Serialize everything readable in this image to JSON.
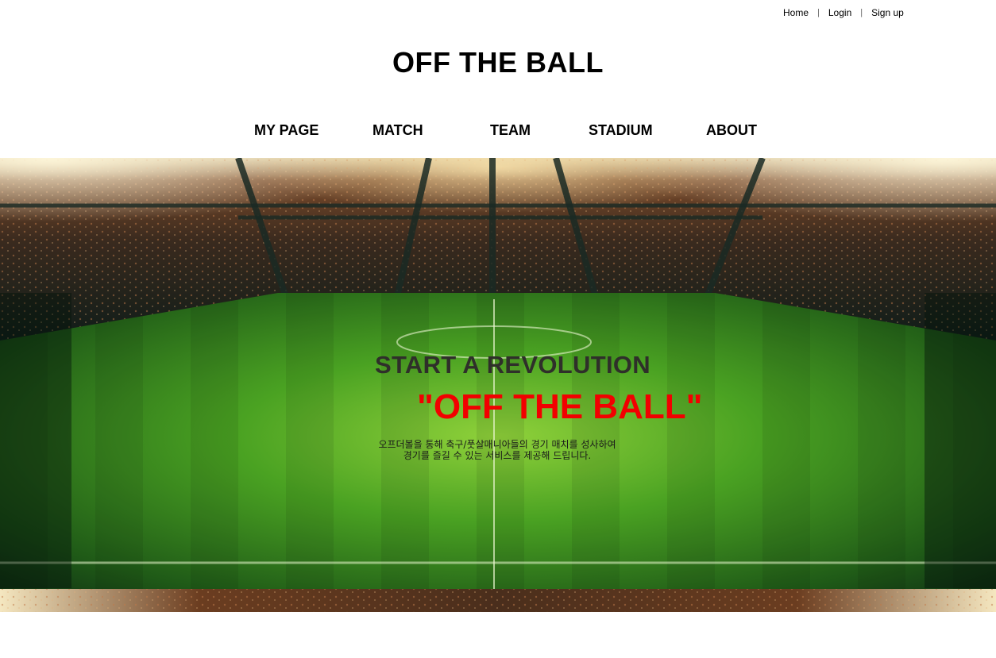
{
  "util_nav": {
    "home": "Home",
    "login": "Login",
    "signup": "Sign up",
    "separator": "|"
  },
  "logo": "OFF THE BALL",
  "main_nav": [
    {
      "label": "MY PAGE"
    },
    {
      "label": "MATCH"
    },
    {
      "label": "TEAM"
    },
    {
      "label": "STADIUM"
    },
    {
      "label": "ABOUT"
    }
  ],
  "hero": {
    "title": "START A REVOLUTION",
    "brand": "\"OFF THE BALL\"",
    "description_line1": "오프더볼을 통해 축구/풋살매니아들의 경기 매치를 성사하여",
    "description_line2": "경기를 즐길 수 있는 서비스를 제공해 드립니다.",
    "image": "stadium-pitch-background"
  },
  "colors": {
    "brand_red": "#f20000",
    "hero_title": "#2f2f2a",
    "pitch_green": "#3f9a1e"
  }
}
